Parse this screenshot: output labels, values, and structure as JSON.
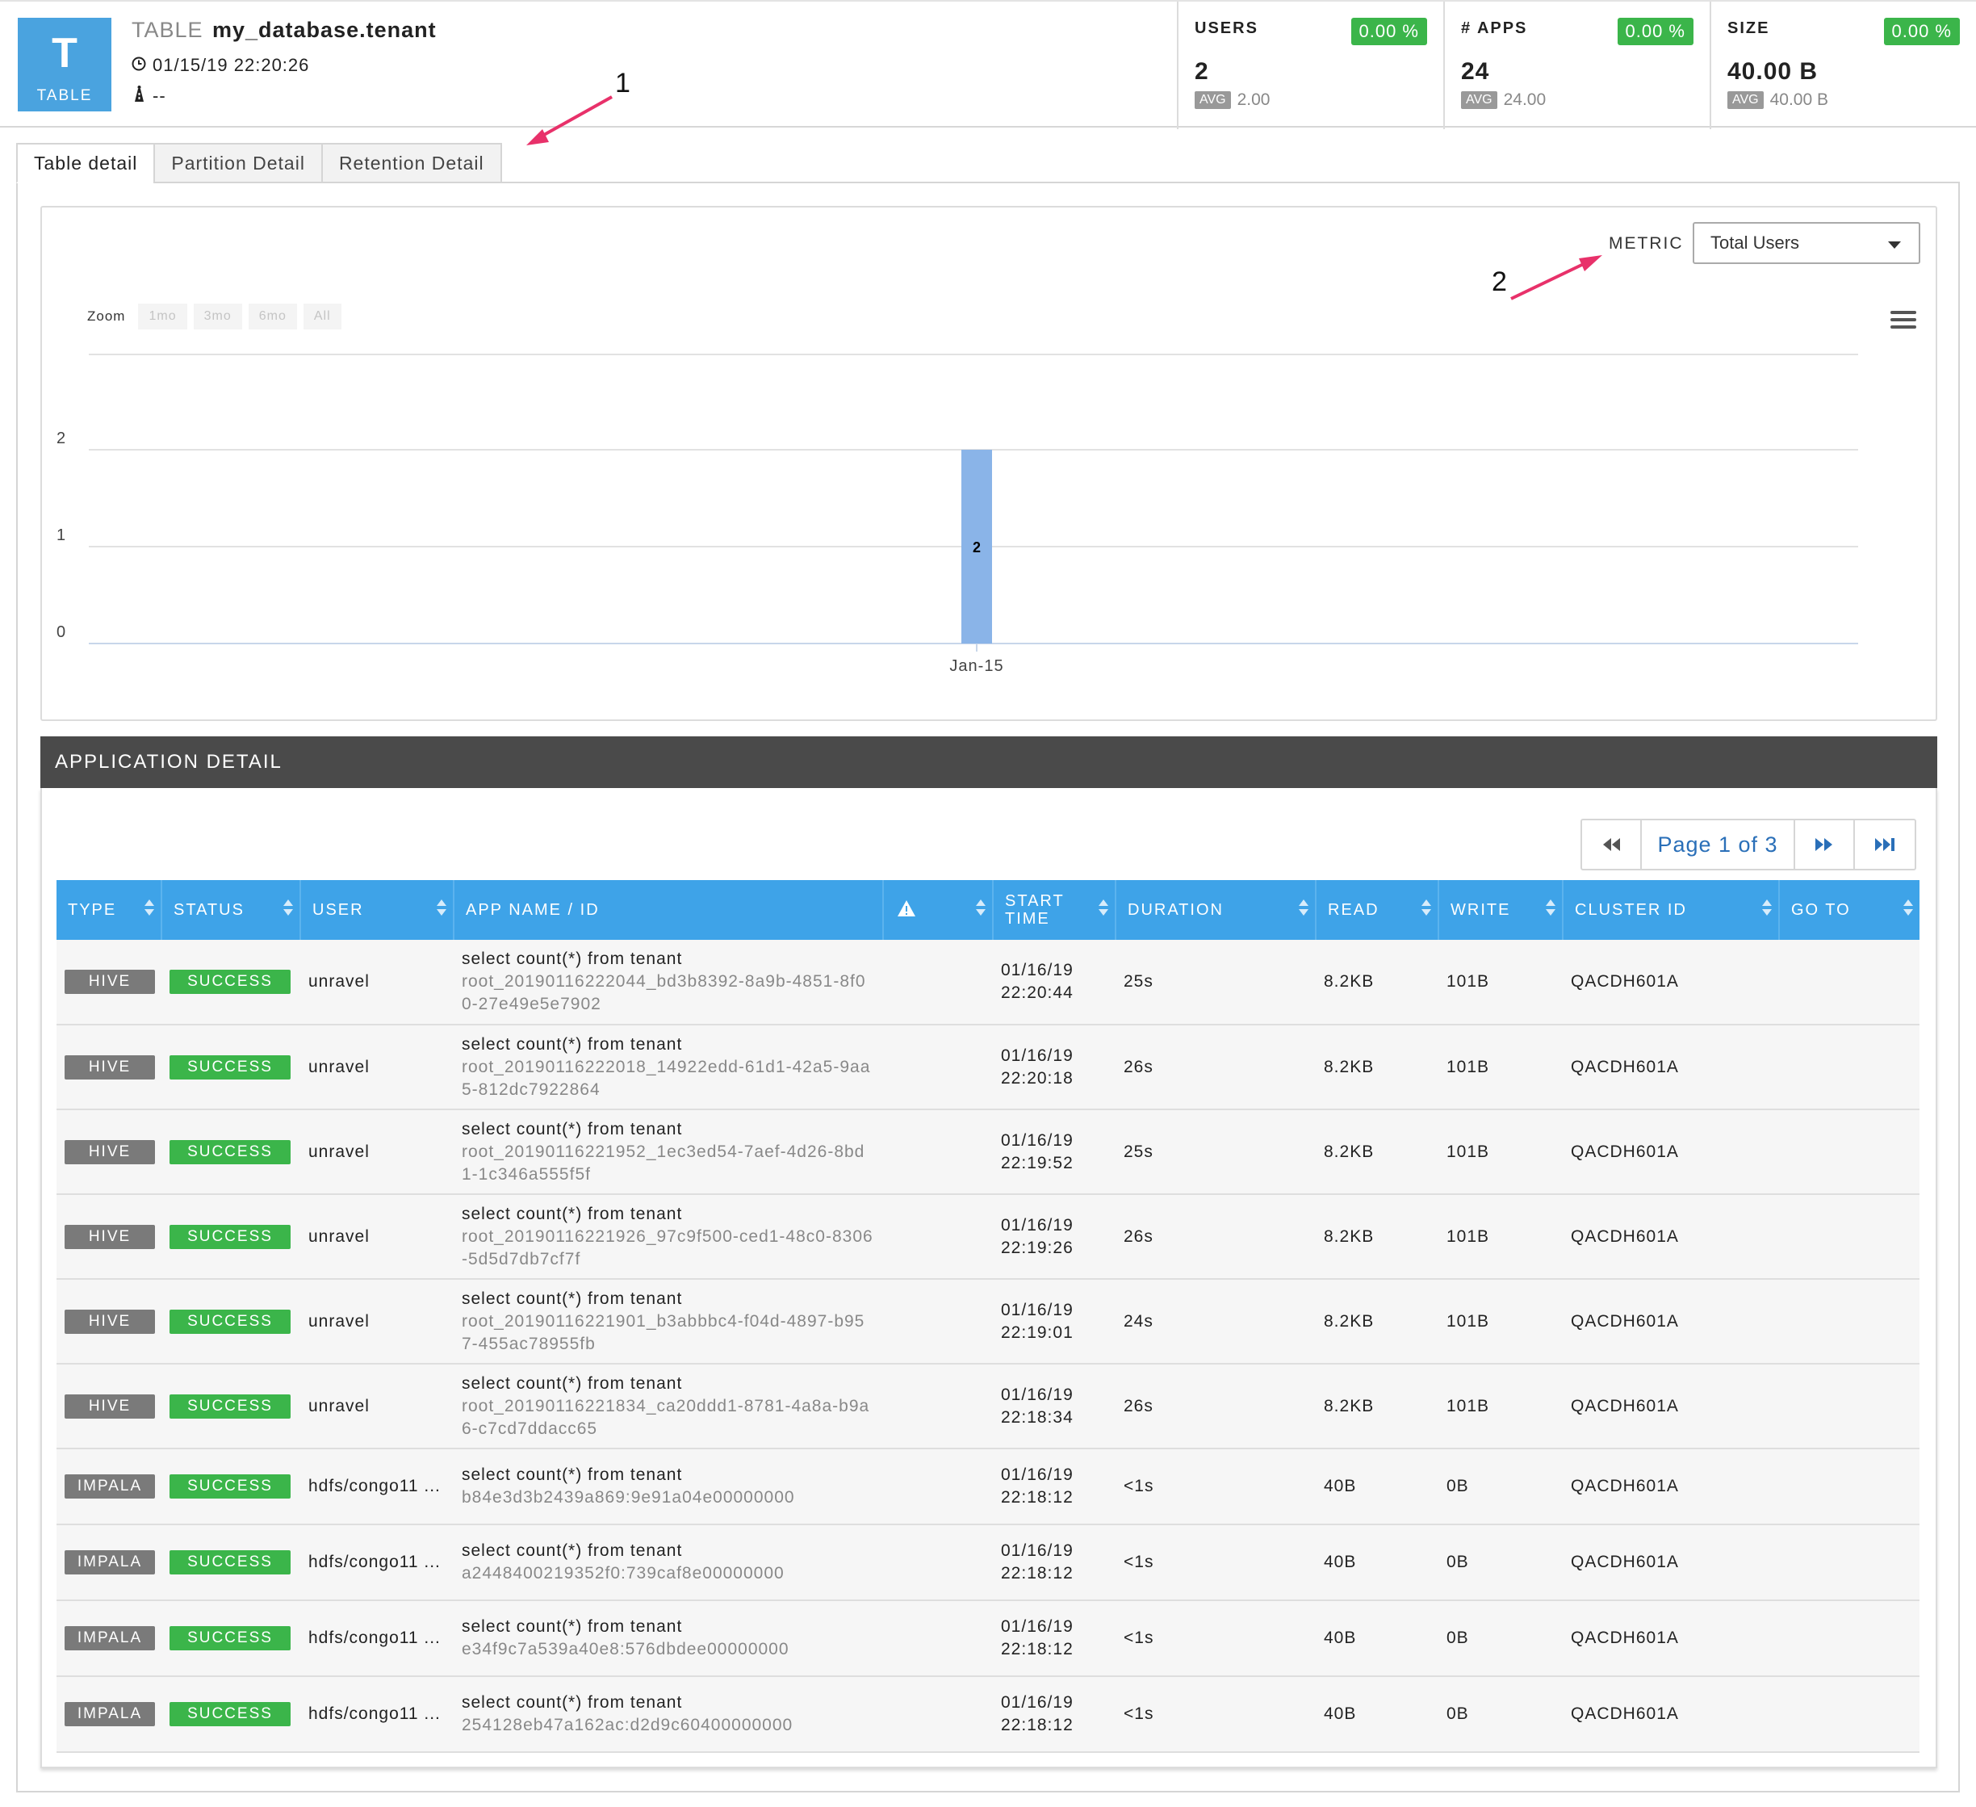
{
  "header": {
    "tile_letter": "T",
    "tile_label": "TABLE",
    "kind_label": "TABLE",
    "table_name": "my_database.tenant",
    "timestamp": "01/15/19 22:20:26",
    "owner": "--",
    "kpis": [
      {
        "title": "USERS",
        "change": "0.00 %",
        "value": "2",
        "avg_label": "AVG",
        "avg": "2.00"
      },
      {
        "title": "# APPS",
        "change": "0.00 %",
        "value": "24",
        "avg_label": "AVG",
        "avg": "24.00"
      },
      {
        "title": "SIZE",
        "change": "0.00 %",
        "value": "40.00 B",
        "avg_label": "AVG",
        "avg": "40.00 B"
      }
    ]
  },
  "tabs": [
    "Table detail",
    "Partition Detail",
    "Retention Detail"
  ],
  "annotations": [
    "1",
    "2"
  ],
  "chart": {
    "metric_label": "METRIC",
    "metric_value": "Total Users",
    "zoom_label": "Zoom",
    "zoom_buttons": [
      "1mo",
      "3mo",
      "6mo",
      "All"
    ]
  },
  "chart_data": {
    "type": "bar",
    "categories": [
      "Jan-15"
    ],
    "values": [
      2
    ],
    "data_labels": [
      "2"
    ],
    "ylim": [
      0,
      2
    ],
    "yticks": [
      "0",
      "1",
      "2"
    ],
    "xlabel": "",
    "ylabel": "",
    "grid": true,
    "bar_color": "#8ab4e8"
  },
  "app_detail": {
    "title": "APPLICATION DETAIL",
    "pager_text": "Page 1 of 3",
    "columns": [
      "TYPE",
      "STATUS",
      "USER",
      "APP NAME / ID",
      "",
      "START TIME",
      "DURATION",
      "READ",
      "WRITE",
      "CLUSTER ID",
      "GO TO"
    ],
    "rows": [
      {
        "type": "HIVE",
        "status": "SUCCESS",
        "user": "unravel",
        "app_name": "select count(*) from tenant",
        "app_id": "root_20190116222044_bd3b8392-8a9b-4851-8f00-27e49e5e7902",
        "start_date": "01/16/19",
        "start_time": "22:20:44",
        "duration": "25s",
        "read": "8.2KB",
        "write": "101B",
        "cluster": "QACDH601A"
      },
      {
        "type": "HIVE",
        "status": "SUCCESS",
        "user": "unravel",
        "app_name": "select count(*) from tenant",
        "app_id": "root_20190116222018_14922edd-61d1-42a5-9aa5-812dc7922864",
        "start_date": "01/16/19",
        "start_time": "22:20:18",
        "duration": "26s",
        "read": "8.2KB",
        "write": "101B",
        "cluster": "QACDH601A"
      },
      {
        "type": "HIVE",
        "status": "SUCCESS",
        "user": "unravel",
        "app_name": "select count(*) from tenant",
        "app_id": "root_20190116221952_1ec3ed54-7aef-4d26-8bd1-1c346a555f5f",
        "start_date": "01/16/19",
        "start_time": "22:19:52",
        "duration": "25s",
        "read": "8.2KB",
        "write": "101B",
        "cluster": "QACDH601A"
      },
      {
        "type": "HIVE",
        "status": "SUCCESS",
        "user": "unravel",
        "app_name": "select count(*) from tenant",
        "app_id": "root_20190116221926_97c9f500-ced1-48c0-8306-5d5d7db7cf7f",
        "start_date": "01/16/19",
        "start_time": "22:19:26",
        "duration": "26s",
        "read": "8.2KB",
        "write": "101B",
        "cluster": "QACDH601A"
      },
      {
        "type": "HIVE",
        "status": "SUCCESS",
        "user": "unravel",
        "app_name": "select count(*) from tenant",
        "app_id": "root_20190116221901_b3abbbc4-f04d-4897-b957-455ac78955fb",
        "start_date": "01/16/19",
        "start_time": "22:19:01",
        "duration": "24s",
        "read": "8.2KB",
        "write": "101B",
        "cluster": "QACDH601A"
      },
      {
        "type": "HIVE",
        "status": "SUCCESS",
        "user": "unravel",
        "app_name": "select count(*) from tenant",
        "app_id": "root_20190116221834_ca20ddd1-8781-4a8a-b9a6-c7cd7ddacc65",
        "start_date": "01/16/19",
        "start_time": "22:18:34",
        "duration": "26s",
        "read": "8.2KB",
        "write": "101B",
        "cluster": "QACDH601A"
      },
      {
        "type": "IMPALA",
        "status": "SUCCESS",
        "user": "hdfs/congo11 ...",
        "app_name": "select count(*) from tenant",
        "app_id": "b84e3d3b2439a869:9e91a04e00000000",
        "start_date": "01/16/19",
        "start_time": "22:18:12",
        "duration": "<1s",
        "read": "40B",
        "write": "0B",
        "cluster": "QACDH601A"
      },
      {
        "type": "IMPALA",
        "status": "SUCCESS",
        "user": "hdfs/congo11 ...",
        "app_name": "select count(*) from tenant",
        "app_id": "a2448400219352f0:739caf8e00000000",
        "start_date": "01/16/19",
        "start_time": "22:18:12",
        "duration": "<1s",
        "read": "40B",
        "write": "0B",
        "cluster": "QACDH601A"
      },
      {
        "type": "IMPALA",
        "status": "SUCCESS",
        "user": "hdfs/congo11 ...",
        "app_name": "select count(*) from tenant",
        "app_id": "e34f9c7a539a40e8:576dbdee00000000",
        "start_date": "01/16/19",
        "start_time": "22:18:12",
        "duration": "<1s",
        "read": "40B",
        "write": "0B",
        "cluster": "QACDH601A"
      },
      {
        "type": "IMPALA",
        "status": "SUCCESS",
        "user": "hdfs/congo11 ...",
        "app_name": "select count(*) from tenant",
        "app_id": "254128eb47a162ac:d2d9c60400000000",
        "start_date": "01/16/19",
        "start_time": "22:18:12",
        "duration": "<1s",
        "read": "40B",
        "write": "0B",
        "cluster": "QACDH601A"
      }
    ]
  }
}
